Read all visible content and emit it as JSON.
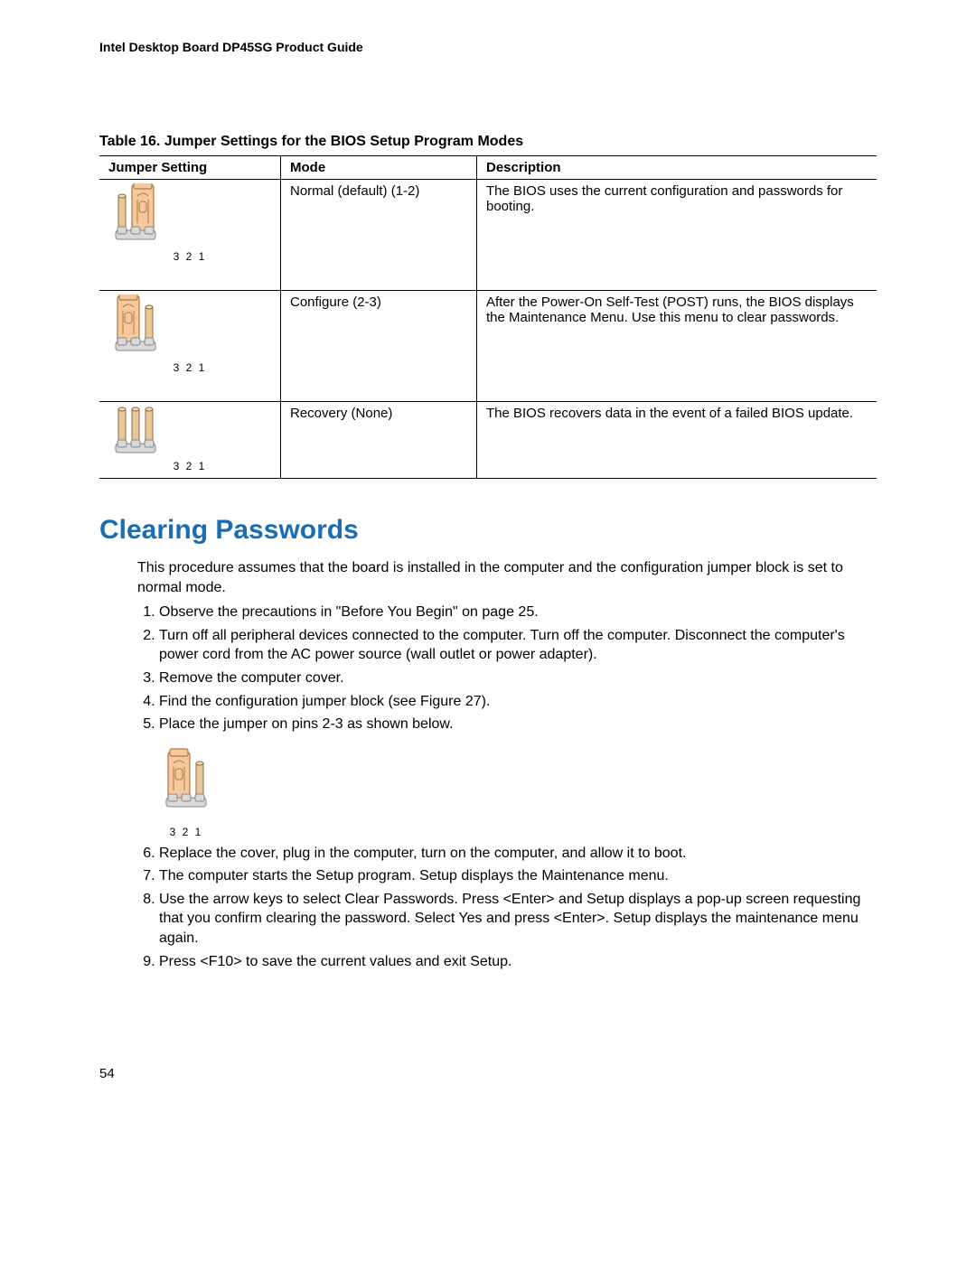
{
  "header": "Intel Desktop Board DP45SG Product Guide",
  "table": {
    "caption": "Table 16. Jumper Settings for the BIOS Setup Program Modes",
    "headers": {
      "jumper": "Jumper Setting",
      "mode": "Mode",
      "description": "Description"
    },
    "rows": [
      {
        "mode": "Normal (default) (1-2)",
        "description": "The BIOS uses the current configuration and passwords for booting.",
        "pin_caption": "3 2 1"
      },
      {
        "mode": "Configure (2-3)",
        "description": "After the Power-On Self-Test (POST) runs, the BIOS displays the Maintenance Menu.  Use this menu to clear passwords.",
        "pin_caption": "3 2 1"
      },
      {
        "mode": "Recovery (None)",
        "description": "The BIOS recovers data in the event of a failed BIOS update.",
        "pin_caption": "3 2 1"
      }
    ]
  },
  "section_title": "Clearing Passwords",
  "intro": "This procedure assumes that the board is installed in the computer and the configuration jumper block is set to normal mode.",
  "steps": {
    "s1": "Observe the precautions in \"Before You Begin\" on page 25.",
    "s2": "Turn off all peripheral devices connected to the computer.  Turn off the computer.  Disconnect the computer's power cord from the AC power source (wall outlet or power adapter).",
    "s3": "Remove the computer cover.",
    "s4": "Find the configuration jumper block (see Figure 27).",
    "s5": "Place the jumper on pins 2-3 as shown below.",
    "figure_caption": "3 2 1",
    "s6": "Replace the cover, plug in the computer, turn on the computer, and allow it to boot.",
    "s7": "The computer starts the Setup program.  Setup displays the Maintenance menu.",
    "s8": "Use the arrow keys to select Clear Passwords.  Press <Enter> and Setup displays a pop-up screen requesting that you confirm clearing the password.  Select Yes and press <Enter>.  Setup displays the maintenance menu again.",
    "s9": "Press <F10> to save the current values and exit Setup."
  },
  "page_number": "54"
}
